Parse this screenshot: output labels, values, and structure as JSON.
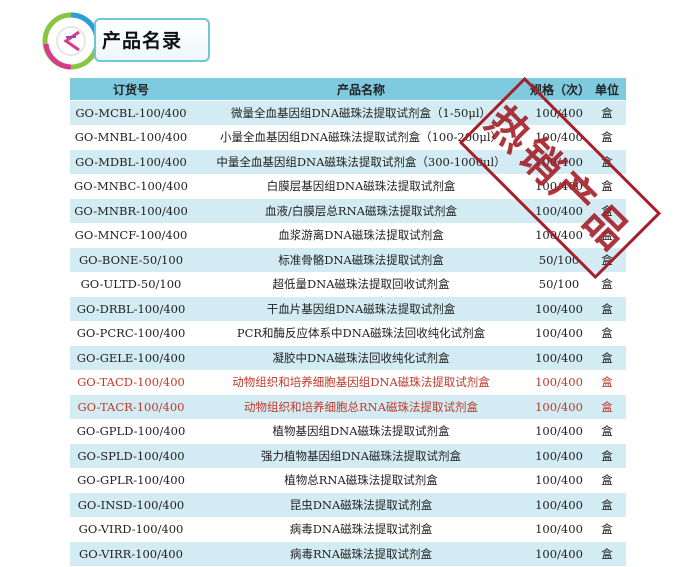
{
  "header": {
    "title": "产品名录",
    "logo_icon": "logo-icon"
  },
  "colors": {
    "header_bg": "#7ecbe0",
    "row_alt": "#d3ecf3",
    "highlight": "#c0392b",
    "stamp": "#a5202a"
  },
  "table": {
    "columns": [
      "订货号",
      "产品名称",
      "规格（次）",
      "单位"
    ],
    "rows": [
      {
        "code": "GO-MCBL-100/400",
        "name": "微量全血基因组DNA磁珠法提取试剂盒（1-50μl）",
        "spec": "100/400",
        "unit": "盒",
        "highlight": false
      },
      {
        "code": "GO-MNBL-100/400",
        "name": "小量全血基因组DNA磁珠法提取试剂盒（100-200μl）",
        "spec": "100/400",
        "unit": "盒",
        "highlight": false
      },
      {
        "code": "GO-MDBL-100/400",
        "name": "中量全血基因组DNA磁珠法提取试剂盒（300-1000μl）",
        "spec": "100/400",
        "unit": "盒",
        "highlight": false
      },
      {
        "code": "GO-MNBC-100/400",
        "name": "白膜层基因组DNA磁珠法提取试剂盒",
        "spec": "100/400",
        "unit": "盒",
        "highlight": false
      },
      {
        "code": "GO-MNBR-100/400",
        "name": "血液/白膜层总RNA磁珠法提取试剂盒",
        "spec": "100/400",
        "unit": "盒",
        "highlight": false
      },
      {
        "code": "GO-MNCF-100/400",
        "name": "血浆游离DNA磁珠法提取试剂盒",
        "spec": "100/400",
        "unit": "盒",
        "highlight": false
      },
      {
        "code": "GO-BONE-50/100",
        "name": "标准骨骼DNA磁珠法提取试剂盒",
        "spec": "50/100",
        "unit": "盒",
        "highlight": false
      },
      {
        "code": "GO-ULTD-50/100",
        "name": "超低量DNA磁珠法提取回收试剂盒",
        "spec": "50/100",
        "unit": "盒",
        "highlight": false
      },
      {
        "code": "GO-DRBL-100/400",
        "name": "干血片基因组DNA磁珠法提取试剂盒",
        "spec": "100/400",
        "unit": "盒",
        "highlight": false
      },
      {
        "code": "GO-PCRC-100/400",
        "name": "PCR和酶反应体系中DNA磁珠法回收纯化试剂盒",
        "spec": "100/400",
        "unit": "盒",
        "highlight": false
      },
      {
        "code": "GO-GELE-100/400",
        "name": "凝胶中DNA磁珠法回收纯化试剂盒",
        "spec": "100/400",
        "unit": "盒",
        "highlight": false
      },
      {
        "code": "GO-TACD-100/400",
        "name": "动物组织和培养细胞基因组DNA磁珠法提取试剂盒",
        "spec": "100/400",
        "unit": "盒",
        "highlight": true
      },
      {
        "code": "GO-TACR-100/400",
        "name": "动物组织和培养细胞总RNA磁珠法提取试剂盒",
        "spec": "100/400",
        "unit": "盒",
        "highlight": true
      },
      {
        "code": "GO-GPLD-100/400",
        "name": "植物基因组DNA磁珠法提取试剂盒",
        "spec": "100/400",
        "unit": "盒",
        "highlight": false
      },
      {
        "code": "GO-SPLD-100/400",
        "name": "强力植物基因组DNA磁珠法提取试剂盒",
        "spec": "100/400",
        "unit": "盒",
        "highlight": false
      },
      {
        "code": "GO-GPLR-100/400",
        "name": "植物总RNA磁珠法提取试剂盒",
        "spec": "100/400",
        "unit": "盒",
        "highlight": false
      },
      {
        "code": "GO-INSD-100/400",
        "name": "昆虫DNA磁珠法提取试剂盒",
        "spec": "100/400",
        "unit": "盒",
        "highlight": false
      },
      {
        "code": "GO-VIRD-100/400",
        "name": "病毒DNA磁珠法提取试剂盒",
        "spec": "100/400",
        "unit": "盒",
        "highlight": false
      },
      {
        "code": "GO-VIRR-100/400",
        "name": "病毒RNA磁珠法提取试剂盒",
        "spec": "100/400",
        "unit": "盒",
        "highlight": false
      }
    ]
  },
  "stamp": {
    "text": "热销产品"
  }
}
